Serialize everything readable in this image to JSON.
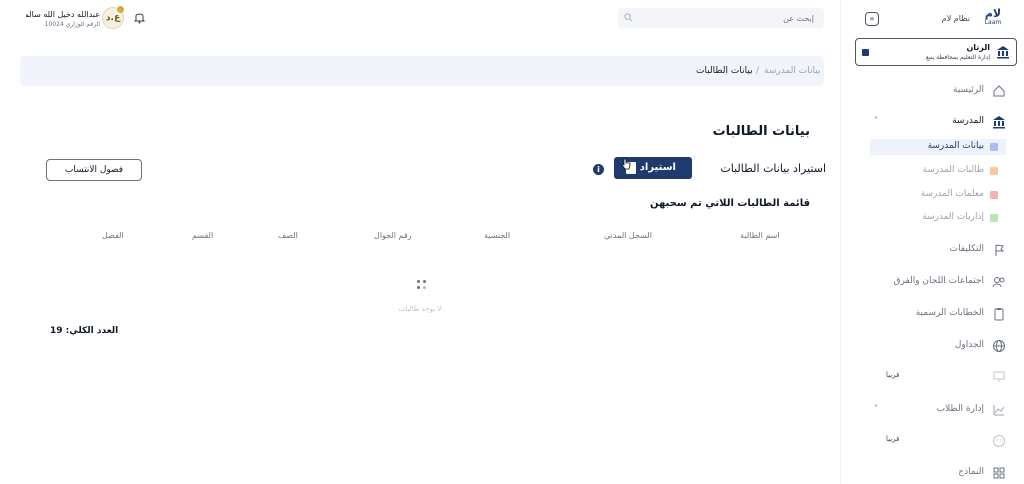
{
  "header": {
    "search_placeholder": "إبحث عن",
    "user_name": "عبدالله دخيل الله سالم...",
    "user_role": "الرقم الوزاري 10024",
    "avatar_initials": "ع.د"
  },
  "sidebar": {
    "logo_ar": "لام",
    "logo_en": "Laam",
    "system_name": "نظام لام",
    "school": {
      "name": "الرتان",
      "subtitle": "إدارة التعليم بمحافظة ينبع"
    },
    "items": [
      {
        "label": "الرئيسية",
        "icon": "home-icon"
      },
      {
        "label": "المدرسة",
        "icon": "bank-icon",
        "expanded": true
      },
      {
        "label": "التكليفات",
        "icon": "flag-icon"
      },
      {
        "label": "اجتماعات اللجان والفرق",
        "icon": "users-icon"
      },
      {
        "label": "الخطابات الرسمية",
        "icon": "clipboard-icon"
      },
      {
        "label": "الجداول",
        "icon": "globe-icon"
      },
      {
        "label": "",
        "icon": "monitor-icon",
        "badge": "قريبا"
      },
      {
        "label": "إدارة الطلاب",
        "icon": "chart-icon"
      },
      {
        "label": "",
        "icon": "smile-icon",
        "badge": "قريبا"
      },
      {
        "label": "النماذج",
        "icon": "grid-icon"
      }
    ],
    "school_subitems": [
      {
        "label": "بيانات المدرسة",
        "color": "#a9bdf0",
        "active": true
      },
      {
        "label": "طالبات المدرسة",
        "color": "#f6c9a8",
        "active": false
      },
      {
        "label": "معلمات المدرسة",
        "color": "#f2b3b3",
        "active": false
      },
      {
        "label": "إداريات المدرسة",
        "color": "#b7e6b0",
        "active": false
      }
    ]
  },
  "breadcrumb": {
    "parent": "بيانات المدرسة",
    "separator": "/",
    "current": "بيانات الطالبات"
  },
  "main": {
    "title": "بيانات الطالبات",
    "import_label": "استيراد بيانات الطالبات",
    "import_button": "استيراد",
    "enrollment_button": "فصول الانتساب",
    "list_title": "قائمة الطالبات اللاتي تم سحبهن",
    "columns": [
      "اسم الطالبة",
      "السجل المدني",
      "الجنسية",
      "رقم الجوال",
      "الصف",
      "القسم",
      "الفصل"
    ],
    "empty_message": "لا يوجد طالبات",
    "total_label": "العدد الكلي: 19"
  },
  "colors": {
    "primary": "#1e3a6e",
    "crumb_bg": "#f1f5fb"
  }
}
